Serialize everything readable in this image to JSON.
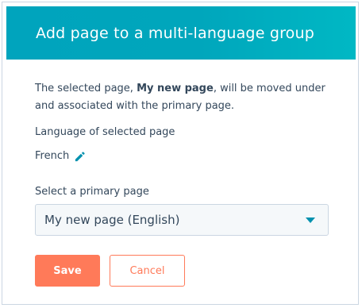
{
  "modal": {
    "title": "Add page to a multi-language group",
    "description": {
      "prefix": "The selected page, ",
      "page_name": "My new page",
      "suffix": ", will be moved under and associated with the primary page."
    },
    "language_label": "Language of selected page",
    "language_value": "French",
    "primary_label": "Select a primary page",
    "primary_value": "My new page (English)",
    "save_label": "Save",
    "cancel_label": "Cancel"
  },
  "colors": {
    "header": "#00a4bd",
    "accent": "#ff7a59",
    "link": "#0091ae",
    "text": "#33475b"
  },
  "icons": {
    "edit": "pencil-icon",
    "dropdown": "caret-down-icon"
  }
}
